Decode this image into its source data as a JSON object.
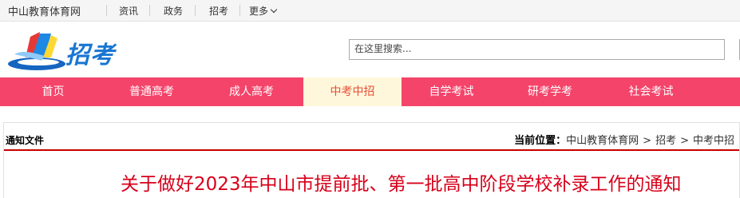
{
  "topbar": {
    "site_name": "中山教育体育网",
    "links": [
      "资讯",
      "政务",
      "招考",
      "更多"
    ]
  },
  "header": {
    "logo_text": "招考",
    "search_placeholder": "在这里搜索..."
  },
  "nav": {
    "items": [
      "首页",
      "普通高考",
      "成人高考",
      "中考中招",
      "自学考试",
      "研考学考",
      "社会考试"
    ],
    "active": "中考中招"
  },
  "panel": {
    "title": "通知文件",
    "breadcrumb_label": "当前位置：",
    "breadcrumb": [
      "中山教育体育网",
      "招考",
      "中考中招"
    ],
    "separator": ">"
  },
  "article": {
    "title": "关于做好2023年中山市提前批、第一批高中阶段学校补录工作的通知"
  },
  "colors": {
    "nav_bg": "#f4446a",
    "nav_active_bg": "#fff7dc",
    "title_red": "#d7001a",
    "brand_blue": "#1976d2"
  }
}
